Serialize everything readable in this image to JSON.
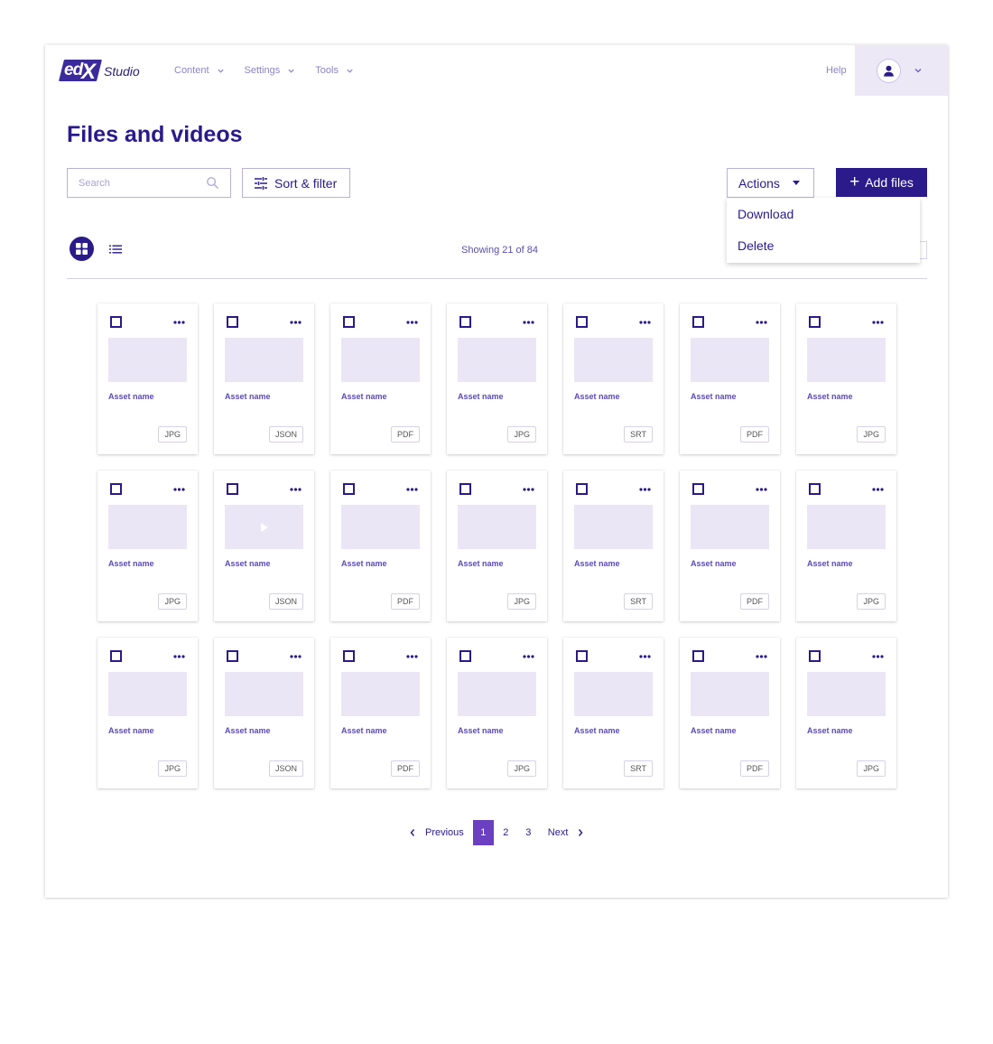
{
  "header": {
    "logo_ed": "ed",
    "logo_x": "X",
    "logo_studio": "Studio",
    "nav": [
      {
        "label": "Content"
      },
      {
        "label": "Settings"
      },
      {
        "label": "Tools"
      }
    ],
    "help": "Help"
  },
  "page": {
    "title": "Files and videos"
  },
  "toolbar": {
    "search_placeholder": "Search",
    "sort_label": "Sort & filter",
    "actions_label": "Actions",
    "add_label": "Add files",
    "dropdown": [
      {
        "label": "Download"
      },
      {
        "label": "Delete"
      }
    ]
  },
  "view": {
    "showing": "Showing 21 of 84"
  },
  "assets": [
    {
      "name": "Asset name",
      "type": "JPG",
      "video": false
    },
    {
      "name": "Asset name",
      "type": "JSON",
      "video": false
    },
    {
      "name": "Asset name",
      "type": "PDF",
      "video": false
    },
    {
      "name": "Asset name",
      "type": "JPG",
      "video": false
    },
    {
      "name": "Asset name",
      "type": "SRT",
      "video": false
    },
    {
      "name": "Asset name",
      "type": "PDF",
      "video": false
    },
    {
      "name": "Asset name",
      "type": "JPG",
      "video": false
    },
    {
      "name": "Asset name",
      "type": "JPG",
      "video": false
    },
    {
      "name": "Asset name",
      "type": "JSON",
      "video": true
    },
    {
      "name": "Asset name",
      "type": "PDF",
      "video": false
    },
    {
      "name": "Asset name",
      "type": "JPG",
      "video": false
    },
    {
      "name": "Asset name",
      "type": "SRT",
      "video": false
    },
    {
      "name": "Asset name",
      "type": "PDF",
      "video": false
    },
    {
      "name": "Asset name",
      "type": "JPG",
      "video": false
    },
    {
      "name": "Asset name",
      "type": "JPG",
      "video": false
    },
    {
      "name": "Asset name",
      "type": "JSON",
      "video": false
    },
    {
      "name": "Asset name",
      "type": "PDF",
      "video": false
    },
    {
      "name": "Asset name",
      "type": "JPG",
      "video": false
    },
    {
      "name": "Asset name",
      "type": "SRT",
      "video": false
    },
    {
      "name": "Asset name",
      "type": "PDF",
      "video": false
    },
    {
      "name": "Asset name",
      "type": "JPG",
      "video": false
    }
  ],
  "pagination": {
    "previous": "Previous",
    "next": "Next",
    "pages": [
      "1",
      "2",
      "3"
    ],
    "current": "1"
  },
  "colors": {
    "brand": "#2a1a8a",
    "accent": "#6a3fc0",
    "thumb": "#ebe6f5"
  }
}
